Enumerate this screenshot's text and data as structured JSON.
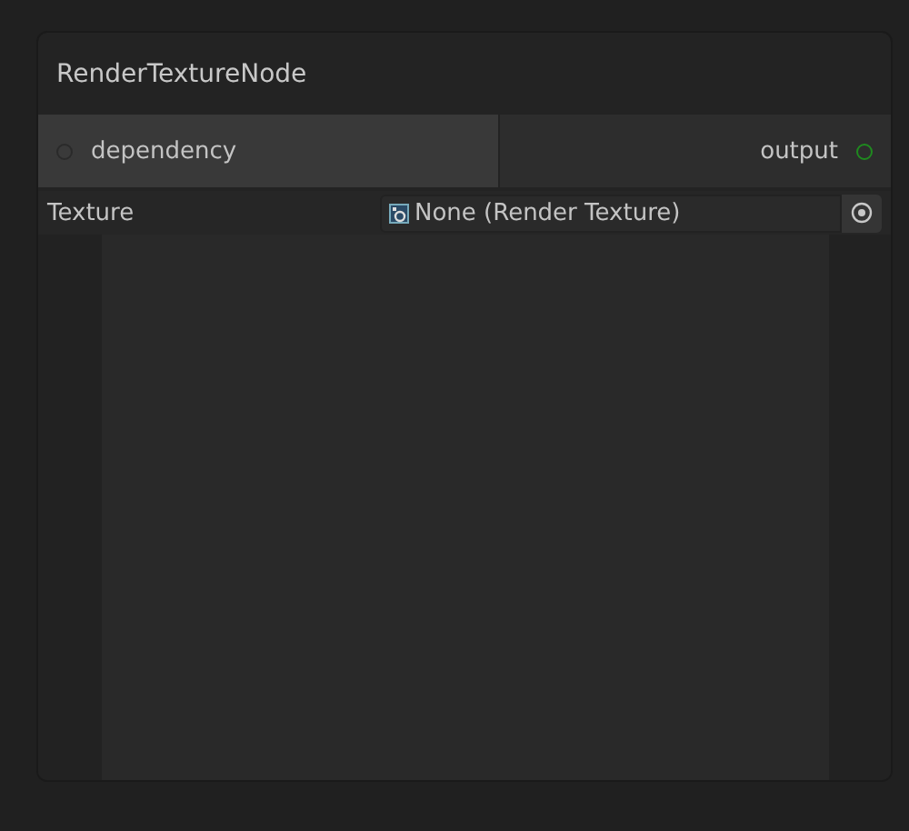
{
  "node": {
    "title": "RenderTextureNode",
    "ports": [
      {
        "kind": "input",
        "label": "dependency",
        "color": "#3a3a3a"
      },
      {
        "kind": "output",
        "label": "output",
        "color": "#1f8a1f"
      }
    ],
    "field": {
      "label": "Texture",
      "value": "None (Render Texture)"
    }
  }
}
